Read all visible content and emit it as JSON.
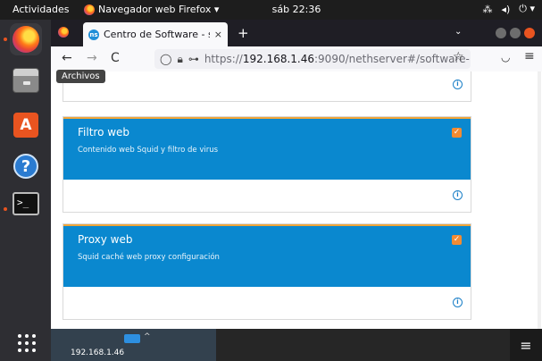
{
  "topbar": {
    "activities": "Actividades",
    "app_name": "Navegador web Firefox ▾",
    "clock": "sáb 22:36"
  },
  "browser": {
    "tab_title": "Centro de Software - serv",
    "tab_close": "×",
    "new_tab": "+",
    "url_host": "192.168.1.46",
    "url_rest": ":9090/nethserver#/software-",
    "url_scheme": "https://",
    "tooltip": "Archivos"
  },
  "cards": [
    {
      "title": "Filtro web",
      "description": "Contenido web Squid y filtro de virus",
      "checked": true
    },
    {
      "title": "Proxy web",
      "description": "Squid caché web proxy configuración",
      "checked": true
    }
  ],
  "bottombar": {
    "ip": "192.168.1.46",
    "caret": "^"
  },
  "icons": {
    "check": "✓",
    "info": "i",
    "back": "←",
    "forward": "→",
    "reload": "C",
    "bookmark": "☆",
    "menu": "≡"
  }
}
